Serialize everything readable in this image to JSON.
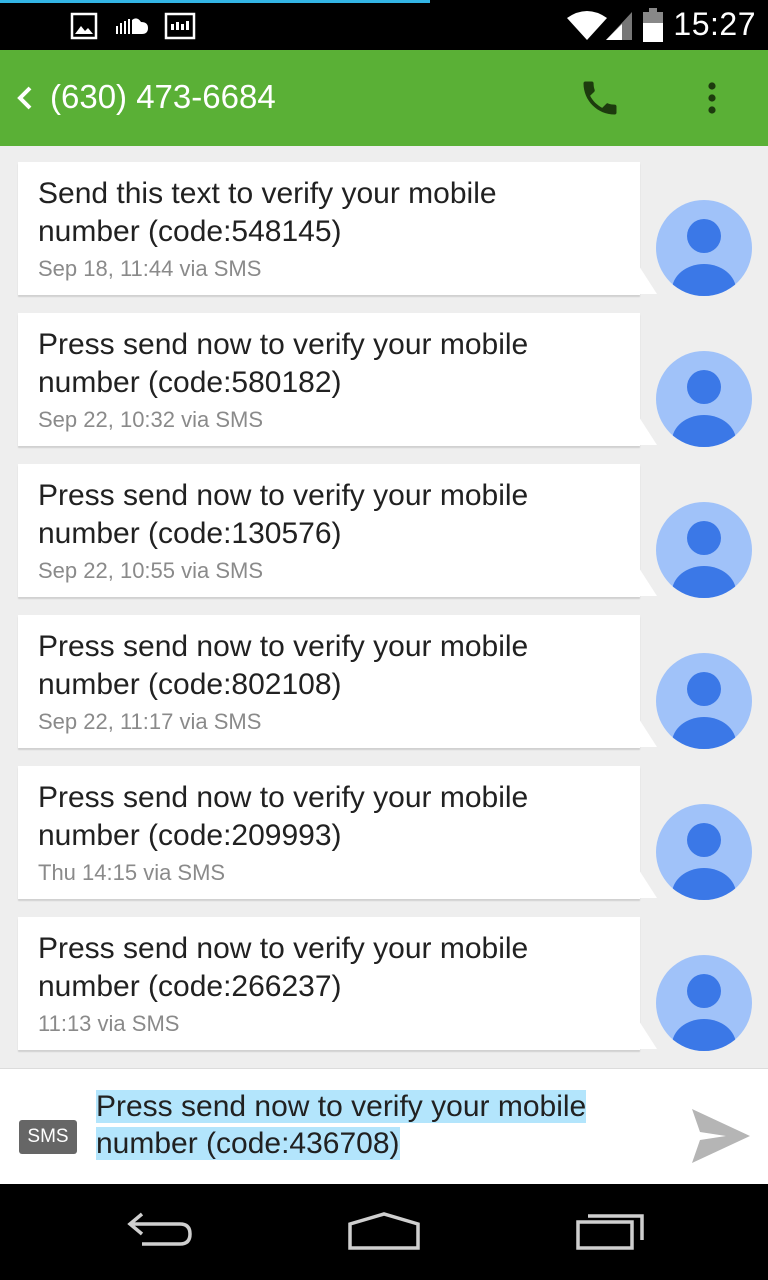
{
  "status_bar": {
    "time": "15:27",
    "icons": [
      "image-notification-icon",
      "soundcloud-icon",
      "radio-icon",
      "wifi-icon",
      "cell-signal-icon",
      "battery-icon"
    ]
  },
  "header": {
    "title": "(630) 473-6684",
    "back_icon": "chevron-left-icon",
    "call_icon": "phone-icon",
    "more_icon": "overflow-menu-icon"
  },
  "messages": [
    {
      "line1": "Send this text to verify your mobile",
      "line2": "number (code:548145)",
      "meta": "Sep 18, 11:44 via SMS"
    },
    {
      "line1": "Press send now to verify your mobile",
      "line2": "number (code:580182)",
      "meta": "Sep 22, 10:32 via SMS"
    },
    {
      "line1": "Press send now to verify your mobile",
      "line2": "number (code:130576)",
      "meta": "Sep 22, 10:55 via SMS"
    },
    {
      "line1": "Press send now to verify your mobile",
      "line2": "number (code:802108)",
      "meta": "Sep 22, 11:17 via SMS"
    },
    {
      "line1": "Press send now to verify your mobile",
      "line2": "number (code:209993)",
      "meta": "Thu 14:15 via SMS"
    },
    {
      "line1": "Press send now to verify your mobile",
      "line2": "number (code:266237)",
      "meta": "11:13 via SMS"
    }
  ],
  "compose": {
    "badge": "SMS",
    "line1": "Press send now to verify your mobile",
    "line2": "number (code:436708)",
    "send_icon": "send-icon"
  },
  "colors": {
    "app_bar": "#5ab036",
    "avatar_bg": "#a0c2f9",
    "avatar_fg": "#3b78e7",
    "selection": "#b3e5fc"
  }
}
